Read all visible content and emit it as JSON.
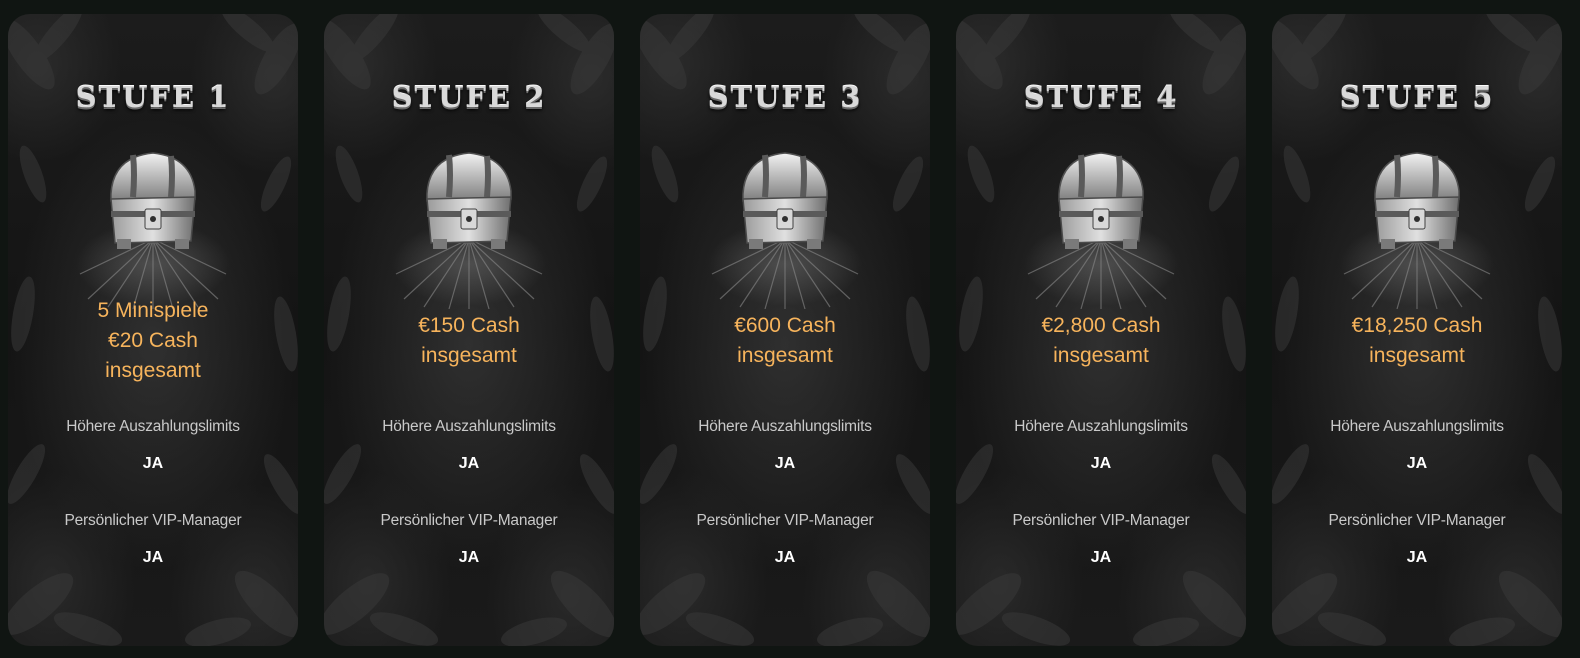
{
  "levels": [
    {
      "title": "STUFE 1",
      "reward_lines": [
        "5 Minispiele",
        "€20 Cash",
        "insgesamt"
      ],
      "features": [
        {
          "label": "Höhere Auszahlungslimits",
          "value": "JA"
        },
        {
          "label": "Persönlicher VIP-Manager",
          "value": "JA"
        }
      ],
      "icon": "treasure-chest-icon"
    },
    {
      "title": "STUFE 2",
      "reward_lines": [
        "€150 Cash",
        "insgesamt"
      ],
      "features": [
        {
          "label": "Höhere Auszahlungslimits",
          "value": "JA"
        },
        {
          "label": "Persönlicher VIP-Manager",
          "value": "JA"
        }
      ],
      "icon": "treasure-chest-icon"
    },
    {
      "title": "STUFE 3",
      "reward_lines": [
        "€600 Cash",
        "insgesamt"
      ],
      "features": [
        {
          "label": "Höhere Auszahlungslimits",
          "value": "JA"
        },
        {
          "label": "Persönlicher VIP-Manager",
          "value": "JA"
        }
      ],
      "icon": "treasure-chest-icon"
    },
    {
      "title": "STUFE 4",
      "reward_lines": [
        "€2,800 Cash",
        "insgesamt"
      ],
      "features": [
        {
          "label": "Höhere Auszahlungslimits",
          "value": "JA"
        },
        {
          "label": "Persönlicher VIP-Manager",
          "value": "JA"
        }
      ],
      "icon": "treasure-chest-icon"
    },
    {
      "title": "STUFE 5",
      "reward_lines": [
        "€18,250 Cash",
        "insgesamt"
      ],
      "features": [
        {
          "label": "Höhere Auszahlungslimits",
          "value": "JA"
        },
        {
          "label": "Persönlicher VIP-Manager",
          "value": "JA"
        }
      ],
      "icon": "treasure-chest-icon"
    }
  ],
  "colors": {
    "page_background": "#101512",
    "reward_text": "#f7b45c",
    "label_text": "#c9c9c9",
    "value_text": "#ffffff"
  }
}
